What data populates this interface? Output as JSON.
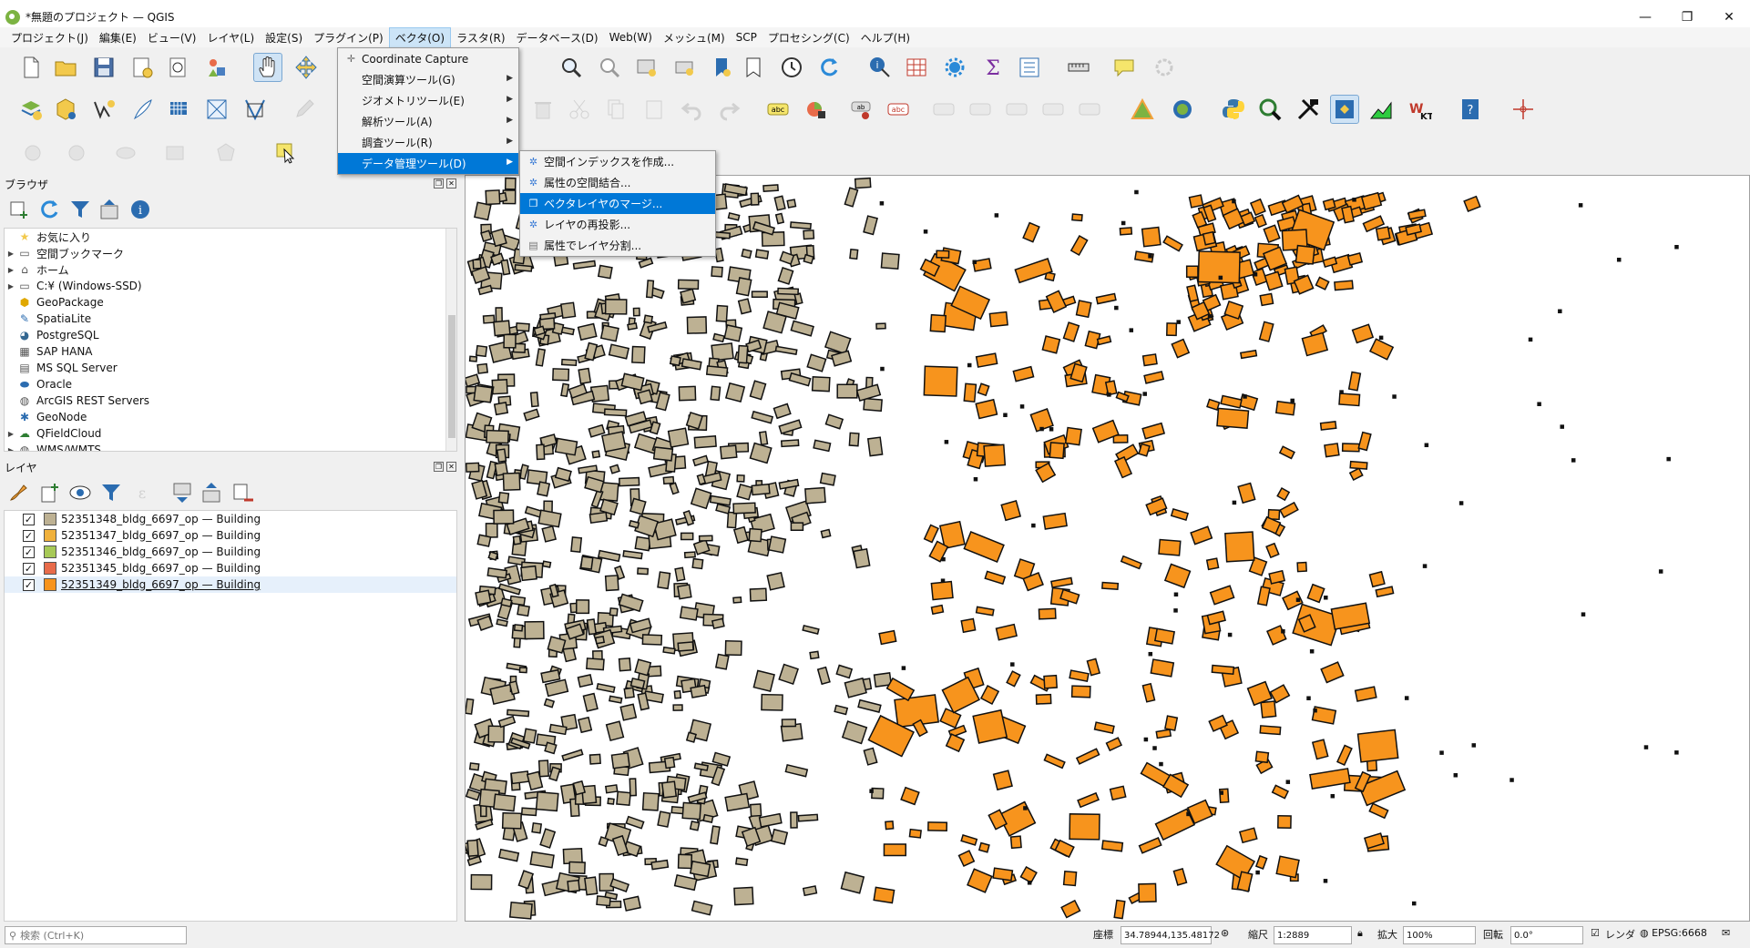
{
  "window": {
    "title": "*無題のプロジェクト — QGIS",
    "minimize": "—",
    "maximize": "❐",
    "close": "✕"
  },
  "menu": [
    "プロジェクト(J)",
    "編集(E)",
    "ビュー(V)",
    "レイヤ(L)",
    "設定(S)",
    "プラグイン(P)",
    "ベクタ(O)",
    "ラスタ(R)",
    "データベース(D)",
    "Web(W)",
    "メッシュ(M)",
    "SCP",
    "プロセシング(C)",
    "ヘルプ(H)"
  ],
  "vector_menu": {
    "items": [
      {
        "label": "Coordinate Capture",
        "icon": "crosshair-icon",
        "submenu": false
      },
      {
        "label": "空間演算ツール(G)",
        "submenu": true
      },
      {
        "label": "ジオメトリツール(E)",
        "submenu": true
      },
      {
        "label": "解析ツール(A)",
        "submenu": true
      },
      {
        "label": "調査ツール(R)",
        "submenu": true
      },
      {
        "label": "データ管理ツール(D)",
        "submenu": true,
        "highlighted": true
      }
    ]
  },
  "data_mgmt_submenu": {
    "items": [
      {
        "label": "空間インデックスを作成...",
        "icon": "gear-icon"
      },
      {
        "label": "属性の空間結合...",
        "icon": "gear-icon"
      },
      {
        "label": "ベクタレイヤのマージ...",
        "icon": "merge-icon",
        "highlighted": true
      },
      {
        "label": "レイヤの再投影...",
        "icon": "gear-icon"
      },
      {
        "label": "属性でレイヤ分割...",
        "icon": "split-icon"
      }
    ]
  },
  "browser": {
    "title": "ブラウザ",
    "items": [
      {
        "label": "お気に入り",
        "icon": "star-icon",
        "expandable": false
      },
      {
        "label": "空間ブックマーク",
        "icon": "bookmark-icon",
        "expandable": true
      },
      {
        "label": "ホーム",
        "icon": "home-icon",
        "expandable": true
      },
      {
        "label": "C:¥ (Windows-SSD)",
        "icon": "drive-icon",
        "expandable": true
      },
      {
        "label": "GeoPackage",
        "icon": "geopackage-icon",
        "expandable": false
      },
      {
        "label": "SpatiaLite",
        "icon": "feather-icon",
        "expandable": false
      },
      {
        "label": "PostgreSQL",
        "icon": "elephant-icon",
        "expandable": false
      },
      {
        "label": "SAP HANA",
        "icon": "database-icon",
        "expandable": false
      },
      {
        "label": "MS SQL Server",
        "icon": "database-icon",
        "expandable": false
      },
      {
        "label": "Oracle",
        "icon": "oracle-icon",
        "expandable": false
      },
      {
        "label": "ArcGIS REST Servers",
        "icon": "globe-icon",
        "expandable": false
      },
      {
        "label": "GeoNode",
        "icon": "geonode-icon",
        "expandable": false
      },
      {
        "label": "QFieldCloud",
        "icon": "cloud-icon",
        "expandable": true
      },
      {
        "label": "WMS/WMTS",
        "icon": "globe-icon",
        "expandable": true
      }
    ]
  },
  "layers": {
    "title": "レイヤ",
    "items": [
      {
        "name": "52351348_bldg_6697_op — Building",
        "color": "#bdb193",
        "checked": true
      },
      {
        "name": "52351347_bldg_6697_op — Building",
        "color": "#f0b13c",
        "checked": true
      },
      {
        "name": "52351346_bldg_6697_op — Building",
        "color": "#a7c957",
        "checked": true
      },
      {
        "name": "52351345_bldg_6697_op — Building",
        "color": "#e86b4a",
        "checked": true
      },
      {
        "name": "52351349_bldg_6697_op — Building",
        "color": "#f7941d",
        "checked": true,
        "selected": true
      }
    ]
  },
  "colors": {
    "tan_building": "#bdb193",
    "orange_building": "#f7941d",
    "outline": "#111111",
    "menu_highlight": "#0078d7"
  },
  "status": {
    "search_placeholder": "検索 (Ctrl+K)",
    "coord_label": "座標",
    "coord_value": "34.78944,135.48172",
    "scale_label": "縮尺",
    "scale_value": "1:2889",
    "zoom_label": "拡大",
    "zoom_value": "100%",
    "rotation_label": "回転",
    "rotation_value": "0.0°",
    "render_label": "レンダ",
    "crs": "EPSG:6668"
  }
}
